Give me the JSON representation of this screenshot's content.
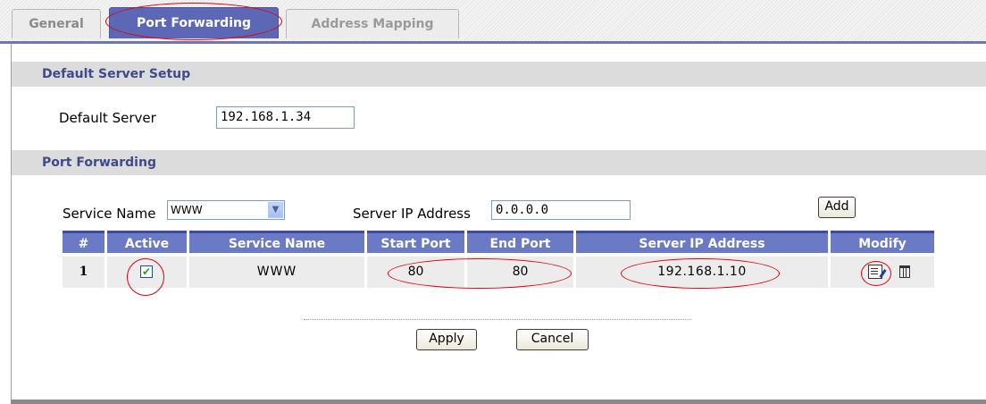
{
  "tabs": [
    {
      "label": "General",
      "selected": false
    },
    {
      "label": "Port Forwarding",
      "selected": true
    },
    {
      "label": "Address Mapping",
      "selected": false
    }
  ],
  "default_server_section": {
    "title": "Default Server Setup",
    "default_server_label": "Default Server",
    "default_server_value": "192.168.1.34"
  },
  "port_forwarding_section": {
    "title": "Port Forwarding",
    "service_name_label": "Service Name",
    "service_name_value": "WWW",
    "server_ip_label": "Server IP Address",
    "server_ip_value": "0.0.0.0",
    "add_label": "Add"
  },
  "table": {
    "columns": [
      "#",
      "Active",
      "Service Name",
      "Start Port",
      "End Port",
      "Server IP Address",
      "Modify"
    ],
    "rows": [
      {
        "index": "1",
        "active": true,
        "service_name": "WWW",
        "start_port": "80",
        "end_port": "80",
        "server_ip": "192.168.1.10"
      }
    ]
  },
  "actions": {
    "apply_label": "Apply",
    "cancel_label": "Cancel"
  },
  "colors": {
    "tab_selected": "#5c68b6",
    "header_bg": "#6a7ac4",
    "section_title": "#3f4a8c",
    "annotation_circle": "#e0000b"
  },
  "icons": [
    "check-icon",
    "edit-icon",
    "trash-icon",
    "dropdown-arrow-icon"
  ]
}
